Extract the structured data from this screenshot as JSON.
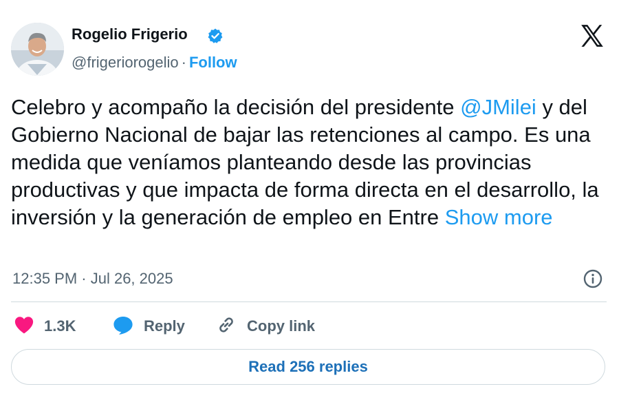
{
  "author": {
    "display_name": "Rogelio Frigerio",
    "handle": "@frigeriorogelio",
    "separator": "·",
    "follow_label": "Follow"
  },
  "tweet": {
    "text_before": "Celebro y acompaño la decisión del presidente ",
    "mention": "@JMilei",
    "text_after": " y del Gobierno Nacional de bajar las retenciones al campo. Es una medida que veníamos planteando desde las provincias productivas y que impacta de forma directa en el desarrollo, la inversión y la generación de empleo en Entre ",
    "show_more_label": "Show more",
    "timestamp": "12:35 PM · Jul 26, 2025"
  },
  "actions": {
    "like_count": "1.3K",
    "reply_label": "Reply",
    "copy_link_label": "Copy link",
    "read_replies_label": "Read 256 replies"
  },
  "icons": {
    "verified": "verified-badge-icon",
    "x_logo": "x-logo-icon",
    "info": "info-icon",
    "heart": "heart-icon",
    "reply": "speech-bubble-icon",
    "link": "link-icon"
  },
  "colors": {
    "accent": "#1d9bf0",
    "like": "#f91880",
    "muted": "#536471",
    "text": "#0f1419"
  }
}
